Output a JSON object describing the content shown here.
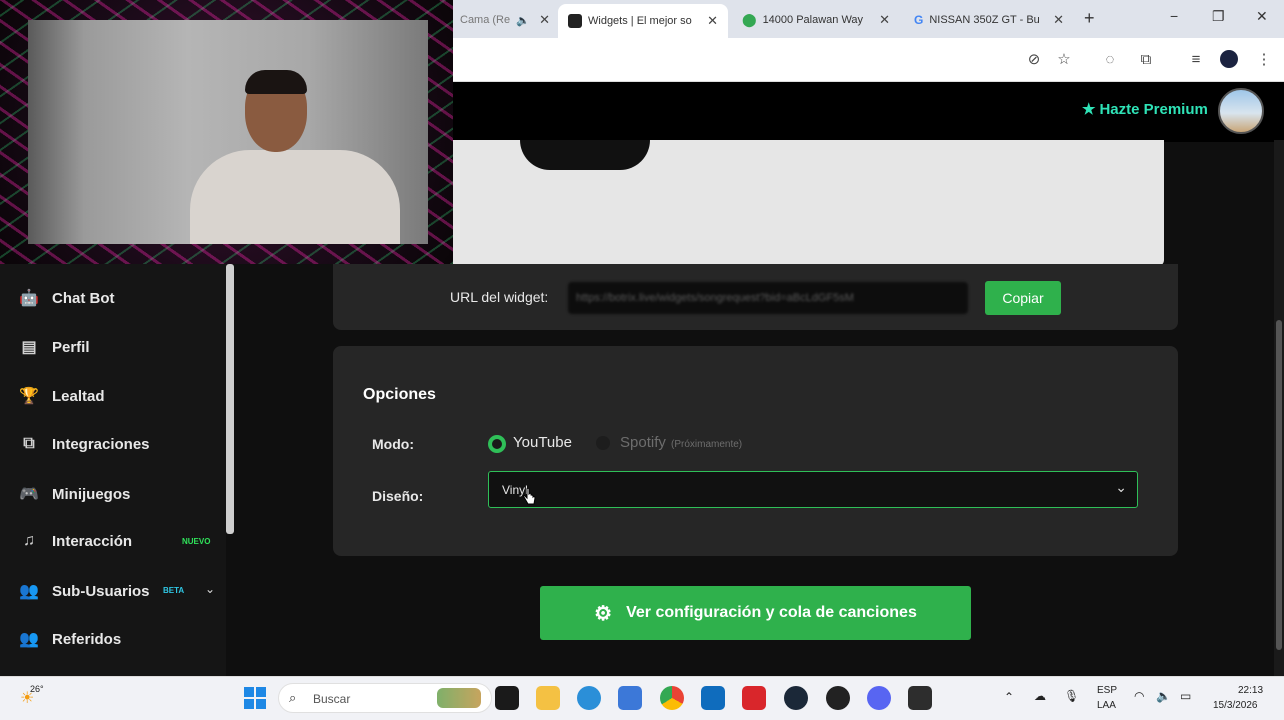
{
  "browser": {
    "tabs": [
      {
        "title": "Cama (Re",
        "muted": true
      },
      {
        "title": "Widgets | El mejor so",
        "active": true
      },
      {
        "title": "14000 Palawan Way"
      },
      {
        "title": "NISSAN 350Z GT - Bu"
      }
    ],
    "new_tab": "+",
    "min": "−",
    "max": "❐",
    "close": "✕"
  },
  "header": {
    "premium_label": "Hazte Premium"
  },
  "sidebar": {
    "items": [
      {
        "label": "Chat Bot",
        "icon": "robot-icon",
        "glyph": "🤖"
      },
      {
        "label": "Perfil",
        "icon": "id-card-icon",
        "glyph": "▤"
      },
      {
        "label": "Lealtad",
        "icon": "trophy-icon",
        "glyph": "🏆"
      },
      {
        "label": "Integraciones",
        "icon": "plug-icon",
        "glyph": "⧉"
      },
      {
        "label": "Minijuegos",
        "icon": "gamepad-icon",
        "glyph": "🎮"
      },
      {
        "label": "Interacción",
        "icon": "music-icon",
        "glyph": "♫",
        "badge": "NUEVO"
      },
      {
        "label": "Sub-Usuarios",
        "icon": "users-icon",
        "glyph": "👥",
        "badge": "BETA"
      },
      {
        "label": "Referidos",
        "icon": "user-group-icon",
        "glyph": "👥"
      }
    ]
  },
  "widget": {
    "url_label": "URL del widget:",
    "url_value": "https://botrix.live/widgets/songrequest?bid=aBcLdGF5sM",
    "copy_label": "Copiar"
  },
  "options": {
    "title": "Opciones",
    "mode_label": "Modo:",
    "mode_youtube": "YouTube",
    "mode_spotify": "Spotify",
    "mode_spotify_note": "(Próximamente)",
    "design_label": "Diseño:",
    "design_value": "Vinyl"
  },
  "cta_label": "Ver configuración y cola de canciones",
  "taskbar": {
    "weather": "26°",
    "search_placeholder": "Buscar",
    "lang": "ESP",
    "lang2": "LAA",
    "time": "22:13",
    "date": "15/3/2026"
  },
  "colors": {
    "accent_green": "#2fb14c",
    "premium_teal": "#2fe3b7",
    "badge_new": "#2fe35a",
    "badge_beta": "#2fc6e3"
  }
}
